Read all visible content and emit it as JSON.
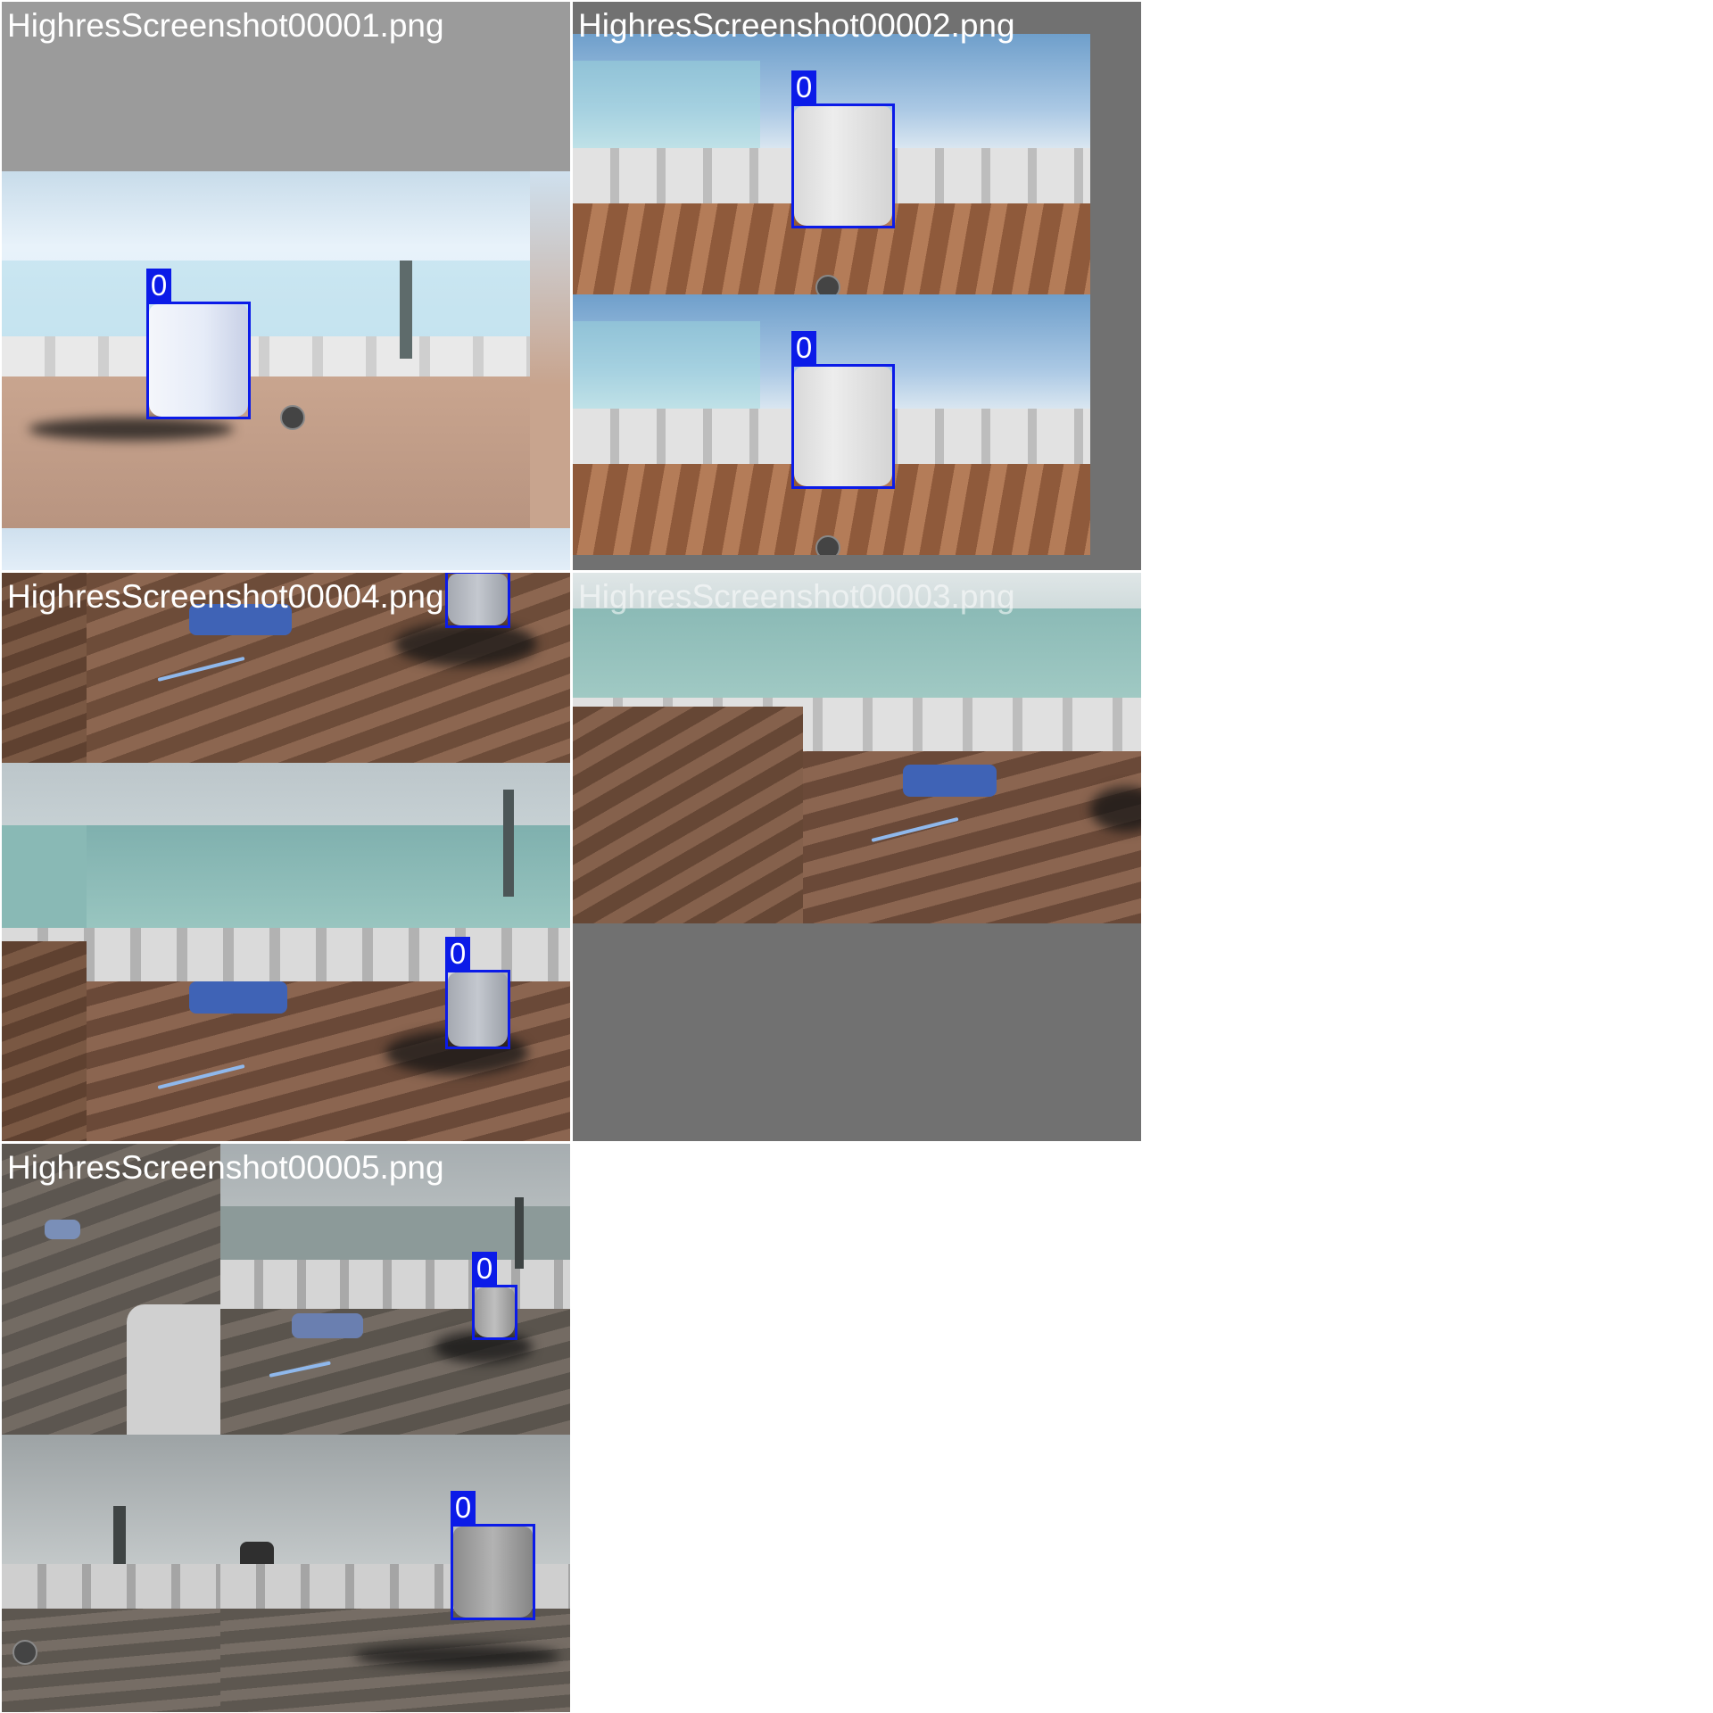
{
  "tiles": [
    {
      "filename": "HighresScreenshot00001.png",
      "detections": [
        {
          "class_id": "0"
        }
      ]
    },
    {
      "filename": "HighresScreenshot00002.png",
      "detections": [
        {
          "class_id": "0"
        },
        {
          "class_id": "0"
        }
      ]
    },
    {
      "filename": "HighresScreenshot00004.png",
      "detections": [
        {
          "class_id": "0"
        },
        {
          "class_id": "0"
        }
      ]
    },
    {
      "filename": "HighresScreenshot00003.png",
      "detections": []
    },
    {
      "filename": "HighresScreenshot00005.png",
      "detections": [
        {
          "class_id": "0"
        },
        {
          "class_id": "0"
        }
      ]
    }
  ],
  "colors": {
    "box": "#0b1be8",
    "padding_gray": "#727272",
    "light_gray": "#9a9a9a"
  }
}
